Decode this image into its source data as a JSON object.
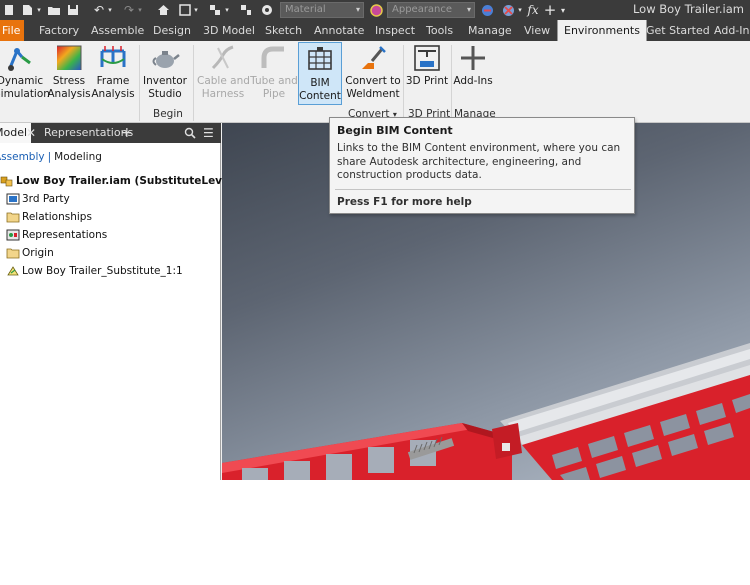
{
  "titlebar": {
    "material_combo": "Material",
    "appearance_combo": "Appearance",
    "fx_label": "fx",
    "app_title": "Low Boy Trailer.iam"
  },
  "ribbon_tabs": [
    {
      "label": "File"
    },
    {
      "label": "Factory"
    },
    {
      "label": "Assemble"
    },
    {
      "label": "Design"
    },
    {
      "label": "3D Model"
    },
    {
      "label": "Sketch"
    },
    {
      "label": "Annotate"
    },
    {
      "label": "Inspect"
    },
    {
      "label": "Tools"
    },
    {
      "label": "Manage"
    },
    {
      "label": "View"
    },
    {
      "label": "Environments"
    },
    {
      "label": "Get Started"
    },
    {
      "label": "Add-Ins"
    }
  ],
  "ribbon": {
    "dynamic_simulation": [
      "Dynamic",
      "Simulation"
    ],
    "stress_analysis": [
      "Stress",
      "Analysis"
    ],
    "frame_analysis": [
      "Frame",
      "Analysis"
    ],
    "inventor_studio": [
      "Inventor",
      "Studio"
    ],
    "cable_harness": [
      "Cable and",
      "Harness"
    ],
    "tube_pipe": [
      "Tube and",
      "Pipe"
    ],
    "bim_content": [
      "BIM",
      "Content"
    ],
    "convert_to_weldment": [
      "Convert to",
      "Weldment"
    ],
    "print_3d": [
      "3D Print"
    ],
    "add_ins": [
      "Add-Ins"
    ],
    "group_begin": "Begin",
    "group_convert": "Convert",
    "group_3dprint": "3D Print",
    "group_manage": "Manage"
  },
  "browser": {
    "tab_model": "Model",
    "tab_representations": "Representations",
    "crumb_assembly": "Assembly",
    "crumb_modeling": "Modeling",
    "nodes": [
      {
        "label": "Low Boy Trailer.iam (SubstituteLevelofDet"
      },
      {
        "label": "3rd Party"
      },
      {
        "label": "Relationships"
      },
      {
        "label": "Representations"
      },
      {
        "label": "Origin"
      },
      {
        "label": "Low Boy Trailer_Substitute_1:1"
      }
    ]
  },
  "tooltip": {
    "title": "Begin BIM Content",
    "body": "Links to the BIM Content environment, where you can share Autodesk architecture, engineering, and construction products data.",
    "help": "Press F1 for more help"
  },
  "colors": {
    "file_tab": "#e8730d",
    "trailer_red": "#d9212b",
    "selection_blue": "#5a9fd6"
  }
}
